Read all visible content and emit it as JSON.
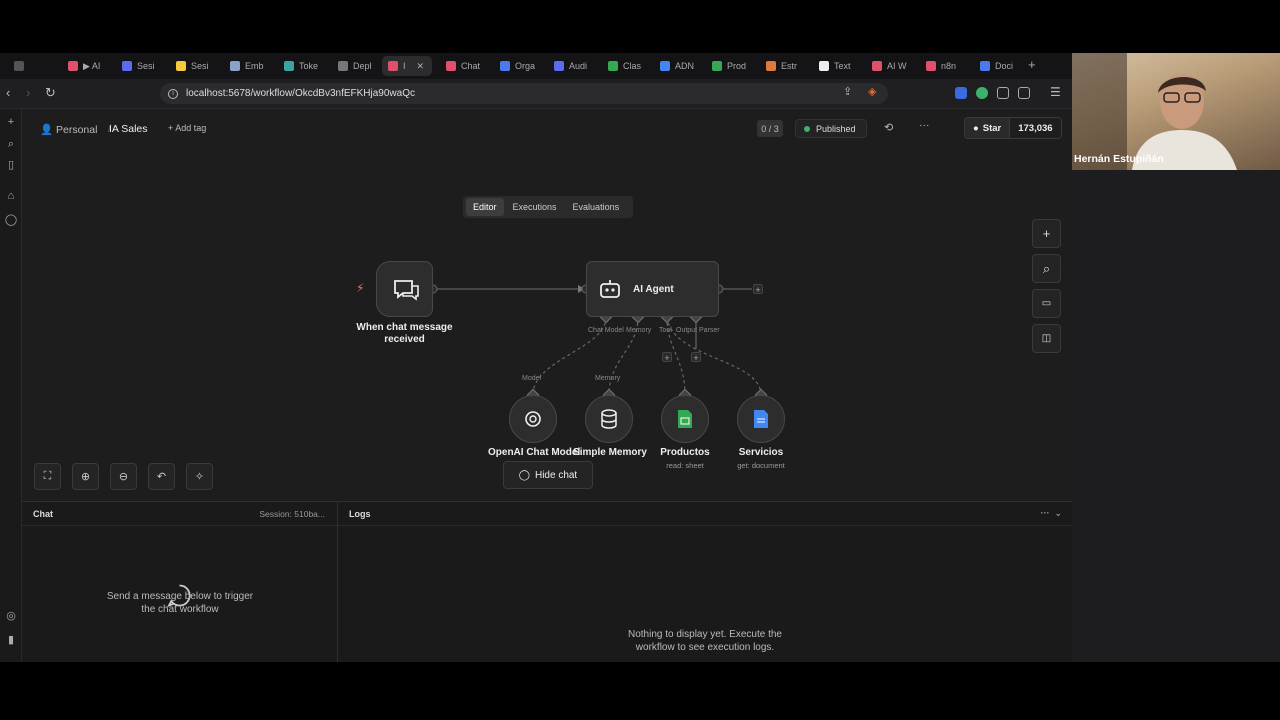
{
  "browser": {
    "tabs": [
      {
        "label": "",
        "color": "#555"
      },
      {
        "label": "▶ AI",
        "color": "#e0506a"
      },
      {
        "label": "Sesi",
        "color": "#5c6bf0"
      },
      {
        "label": "Sesi",
        "color": "#f4c93b"
      },
      {
        "label": "Emb",
        "color": "#8ba3c9"
      },
      {
        "label": "Toke",
        "color": "#3ba3a0"
      },
      {
        "label": "Depl",
        "color": "#777"
      },
      {
        "label": "I",
        "color": "#e0506a"
      },
      {
        "label": "Chat",
        "color": "#e0506a"
      },
      {
        "label": "Orga",
        "color": "#4d79f0"
      },
      {
        "label": "Audi",
        "color": "#5c6bf0"
      },
      {
        "label": "Clas",
        "color": "#34a853"
      },
      {
        "label": "ADN",
        "color": "#4285f4"
      },
      {
        "label": "Prod",
        "color": "#34a853"
      },
      {
        "label": "Estr",
        "color": "#e07a3b"
      },
      {
        "label": "Text",
        "color": "#eee"
      },
      {
        "label": "AI W",
        "color": "#e0506a"
      },
      {
        "label": "n8n",
        "color": "#e0506a"
      },
      {
        "label": "Doci",
        "color": "#4d79f0"
      }
    ],
    "new_tab": "+",
    "url": "localhost:5678/workflow/OkcdBv3nfEFKHja90waQc"
  },
  "header": {
    "project": "Personal",
    "workflow_name": "IA Sales",
    "add_tag": "+ Add tag",
    "counter": "0 / 3",
    "status": "Published",
    "star_label": "Star",
    "star_count": "173,036"
  },
  "modes": [
    "Editor",
    "Executions",
    "Evaluations"
  ],
  "nodes": {
    "trigger_label": "When chat message received",
    "agent_label": "AI Agent",
    "agent_ports": {
      "chat_model": "Chat Model",
      "memory": "Memory",
      "tool": "Tool",
      "output_parser": "Output Parser"
    },
    "sub_nodes": [
      {
        "label": "OpenAI Chat Model",
        "port": "Model",
        "sub": ""
      },
      {
        "label": "Simple Memory",
        "port": "Memory",
        "sub": ""
      },
      {
        "label": "Productos",
        "port": "",
        "sub": "read: sheet"
      },
      {
        "label": "Servicios",
        "port": "",
        "sub": "get: document"
      }
    ]
  },
  "hide_chat": "Hide chat",
  "chat_panel": {
    "title": "Chat",
    "session": "Session: 510ba...",
    "empty_line1": "Send a message below to trigger",
    "empty_line2": "the chat workflow"
  },
  "logs_panel": {
    "title": "Logs",
    "empty_line1": "Nothing to display yet. Execute the",
    "empty_line2": "workflow to see execution logs."
  },
  "webcam": {
    "name": "Hernán Estupiñán"
  },
  "colors": {
    "accent": "#ff6d5a",
    "published": "#3bb36b",
    "sheet_green": "#34a853",
    "doc_blue": "#4285f4"
  }
}
